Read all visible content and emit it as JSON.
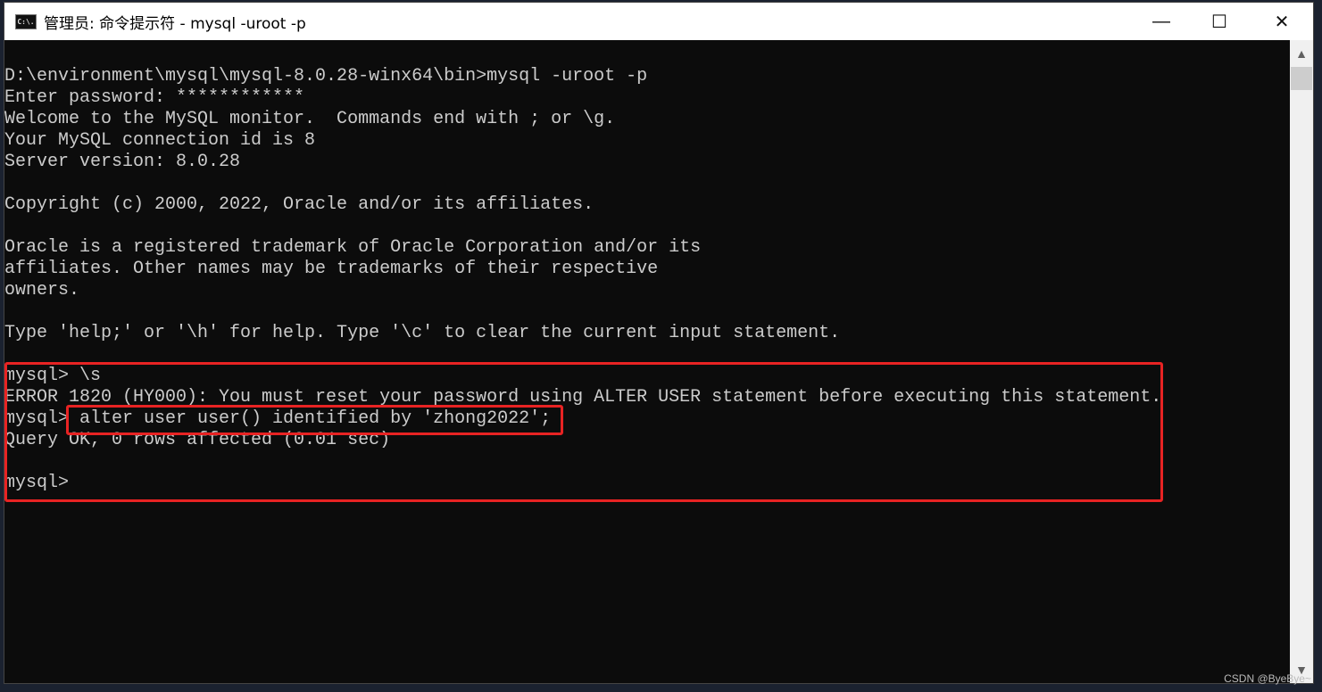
{
  "window": {
    "title": "管理员: 命令提示符 - mysql  -uroot -p",
    "app_icon_text": "C:\\."
  },
  "terminal": {
    "lines": [
      "D:\\environment\\mysql\\mysql-8.0.28-winx64\\bin>mysql -uroot -p",
      "Enter password: ************",
      "Welcome to the MySQL monitor.  Commands end with ; or \\g.",
      "Your MySQL connection id is 8",
      "Server version: 8.0.28",
      "",
      "Copyright (c) 2000, 2022, Oracle and/or its affiliates.",
      "",
      "Oracle is a registered trademark of Oracle Corporation and/or its",
      "affiliates. Other names may be trademarks of their respective",
      "owners.",
      "",
      "Type 'help;' or '\\h' for help. Type '\\c' to clear the current input statement.",
      "",
      "mysql> \\s",
      "ERROR 1820 (HY000): You must reset your password using ALTER USER statement before executing this statement.",
      "mysql> alter user user() identified by 'zhong2022';",
      "Query OK, 0 rows affected (0.01 sec)",
      "",
      "mysql>"
    ]
  },
  "highlight_color": "#e82323",
  "watermark": "CSDN @ByeBye~"
}
